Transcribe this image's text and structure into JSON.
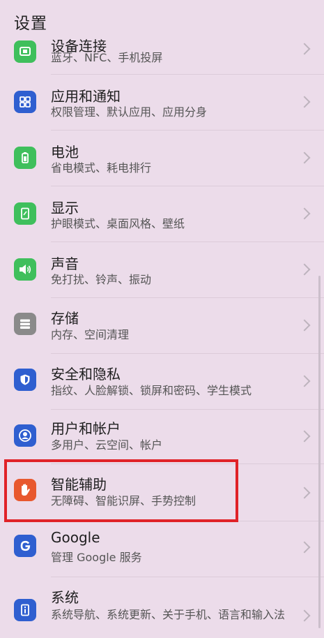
{
  "header": {
    "title": "设置"
  },
  "items": [
    {
      "title": "设备连接",
      "subtitle": "蓝牙、NFC、手机投屏",
      "icon": "device-connection-icon",
      "color": "#3fbf5c"
    },
    {
      "title": "应用和通知",
      "subtitle": "权限管理、默认应用、应用分身",
      "icon": "apps-grid-icon",
      "color": "#2f5fd0"
    },
    {
      "title": "电池",
      "subtitle": "省电模式、耗电排行",
      "icon": "battery-icon",
      "color": "#3fbf5c"
    },
    {
      "title": "显示",
      "subtitle": "护眼模式、桌面风格、壁纸",
      "icon": "display-phone-icon",
      "color": "#3fbf5c"
    },
    {
      "title": "声音",
      "subtitle": "免打扰、铃声、振动",
      "icon": "speaker-icon",
      "color": "#3fbf5c"
    },
    {
      "title": "存储",
      "subtitle": "内存、空间清理",
      "icon": "storage-icon",
      "color": "#8a8a8a"
    },
    {
      "title": "安全和隐私",
      "subtitle": "指纹、人脸解锁、锁屏和密码、学生模式",
      "icon": "shield-icon",
      "color": "#2f5fd0"
    },
    {
      "title": "用户和帐户",
      "subtitle": "多用户、云空间、帐户",
      "icon": "user-account-icon",
      "color": "#2f5fd0"
    },
    {
      "title": "智能辅助",
      "subtitle": "无障碍、智能识屏、手势控制",
      "icon": "hand-icon",
      "color": "#e8582e"
    },
    {
      "title": "Google",
      "subtitle": "管理 Google 服务",
      "icon": "google-icon",
      "color": "#2f5fd0"
    },
    {
      "title": "系统",
      "subtitle": "系统导航、系统更新、关于手机、语言和输入法",
      "icon": "system-info-icon",
      "color": "#2f5fd0"
    }
  ]
}
